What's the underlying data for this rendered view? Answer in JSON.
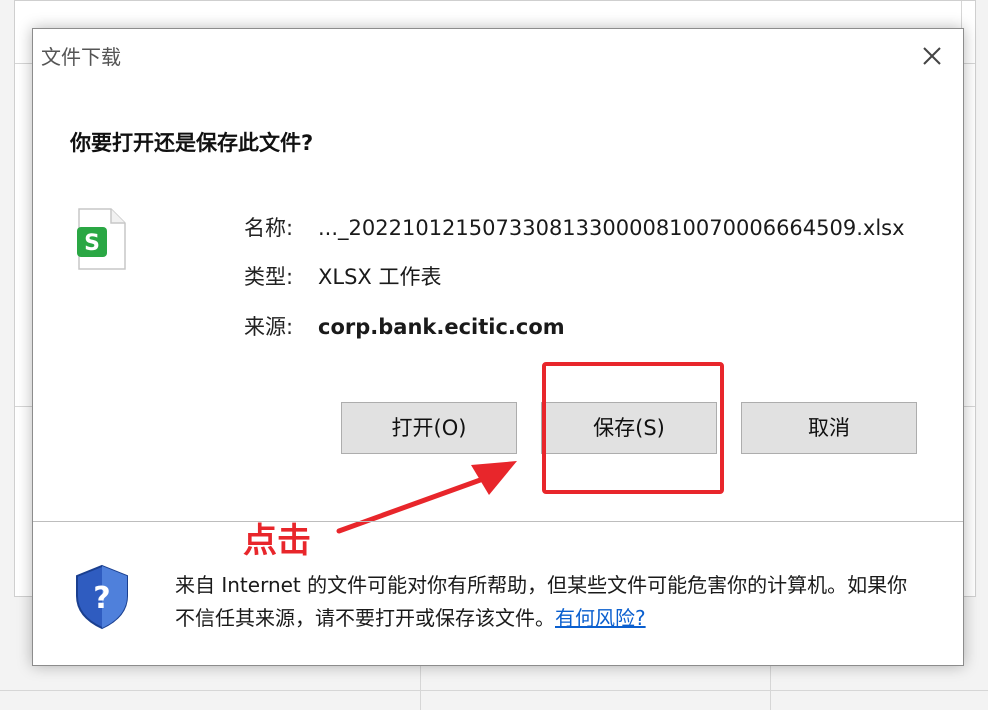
{
  "dialog": {
    "title": "文件下载",
    "question": "你要打开还是保存此文件?",
    "file": {
      "name_label": "名称:",
      "name_value": "..._20221012150733081330000810070006664509.xlsx",
      "type_label": "类型:",
      "type_value": "XLSX 工作表",
      "source_label": "来源:",
      "source_value": "corp.bank.ecitic.com",
      "icon_letter": "S",
      "icon_color": "#2aa744"
    },
    "buttons": {
      "open": "打开(O)",
      "save": "保存(S)",
      "cancel": "取消"
    },
    "warning": {
      "text": "来自 Internet 的文件可能对你有所帮助，但某些文件可能危害你的计算机。如果你不信任其来源，请不要打开或保存该文件。",
      "link": "有何风险?"
    }
  },
  "annotation": {
    "label": "点击",
    "color": "#e8262b"
  },
  "colors": {
    "link": "#0a5fcf",
    "button_bg": "#e1e1e1"
  }
}
